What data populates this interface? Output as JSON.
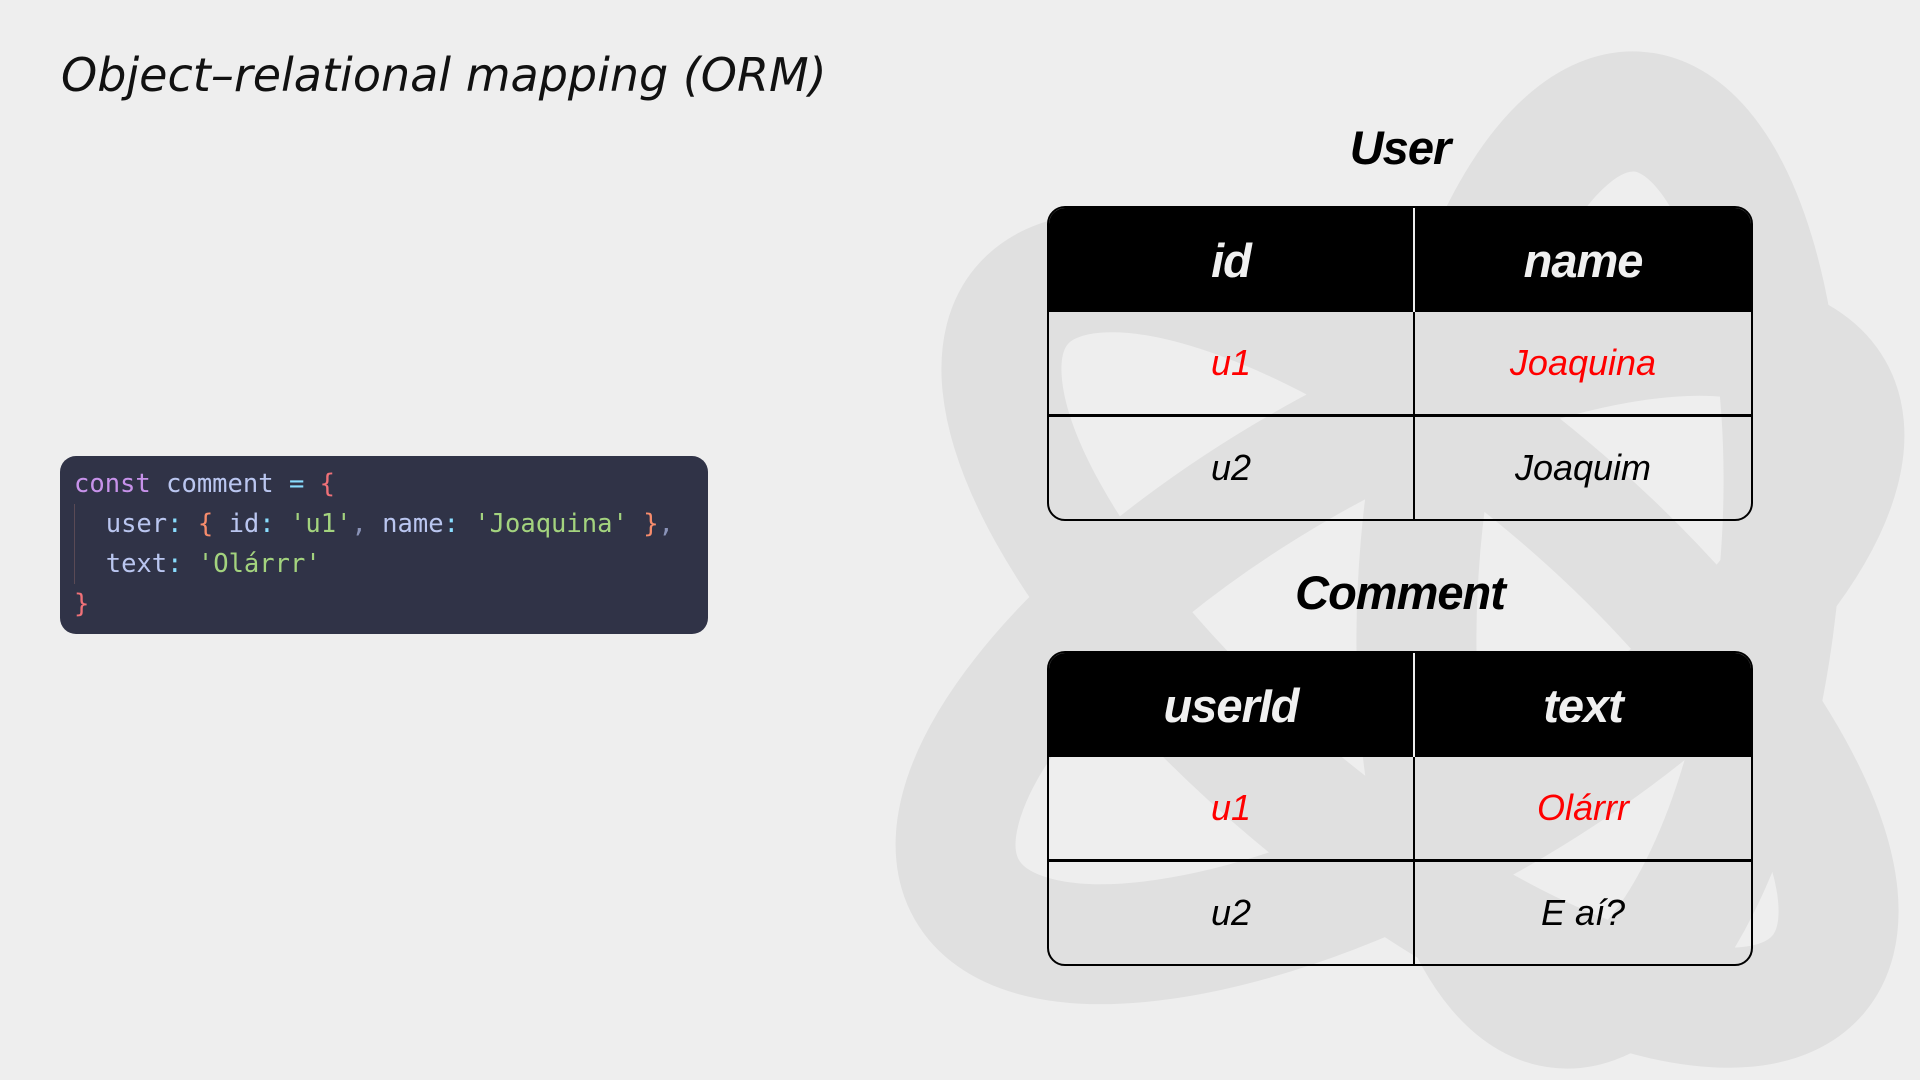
{
  "slide_title": "Object–relational mapping (ORM)",
  "code": {
    "line1": {
      "kw": "const",
      "name": "comment",
      "op": "=",
      "brace": "{"
    },
    "line2": {
      "key": "user",
      "colon": ":",
      "open": "{",
      "k1": "id",
      "v1": "'u1'",
      "comma": ",",
      "k2": "name",
      "v2": "'Joaquina'",
      "close": "}",
      "trail": ","
    },
    "line3": {
      "key": "text",
      "colon": ":",
      "v": "'Olárrr'"
    },
    "line4": {
      "brace": "}"
    }
  },
  "user_table": {
    "title": "User",
    "headers": [
      "id",
      "name"
    ],
    "rows": [
      [
        "u1",
        "Joaquina"
      ],
      [
        "u2",
        "Joaquim"
      ]
    ]
  },
  "comment_table": {
    "title": "Comment",
    "headers": [
      "userId",
      "text"
    ],
    "rows": [
      [
        "u1",
        "Olárrr"
      ],
      [
        "u2",
        "E aí?"
      ]
    ]
  },
  "colors": {
    "highlight": "#ff0000",
    "background": "#eeeeee",
    "code_bg": "#303347",
    "header_bg": "#000000"
  }
}
